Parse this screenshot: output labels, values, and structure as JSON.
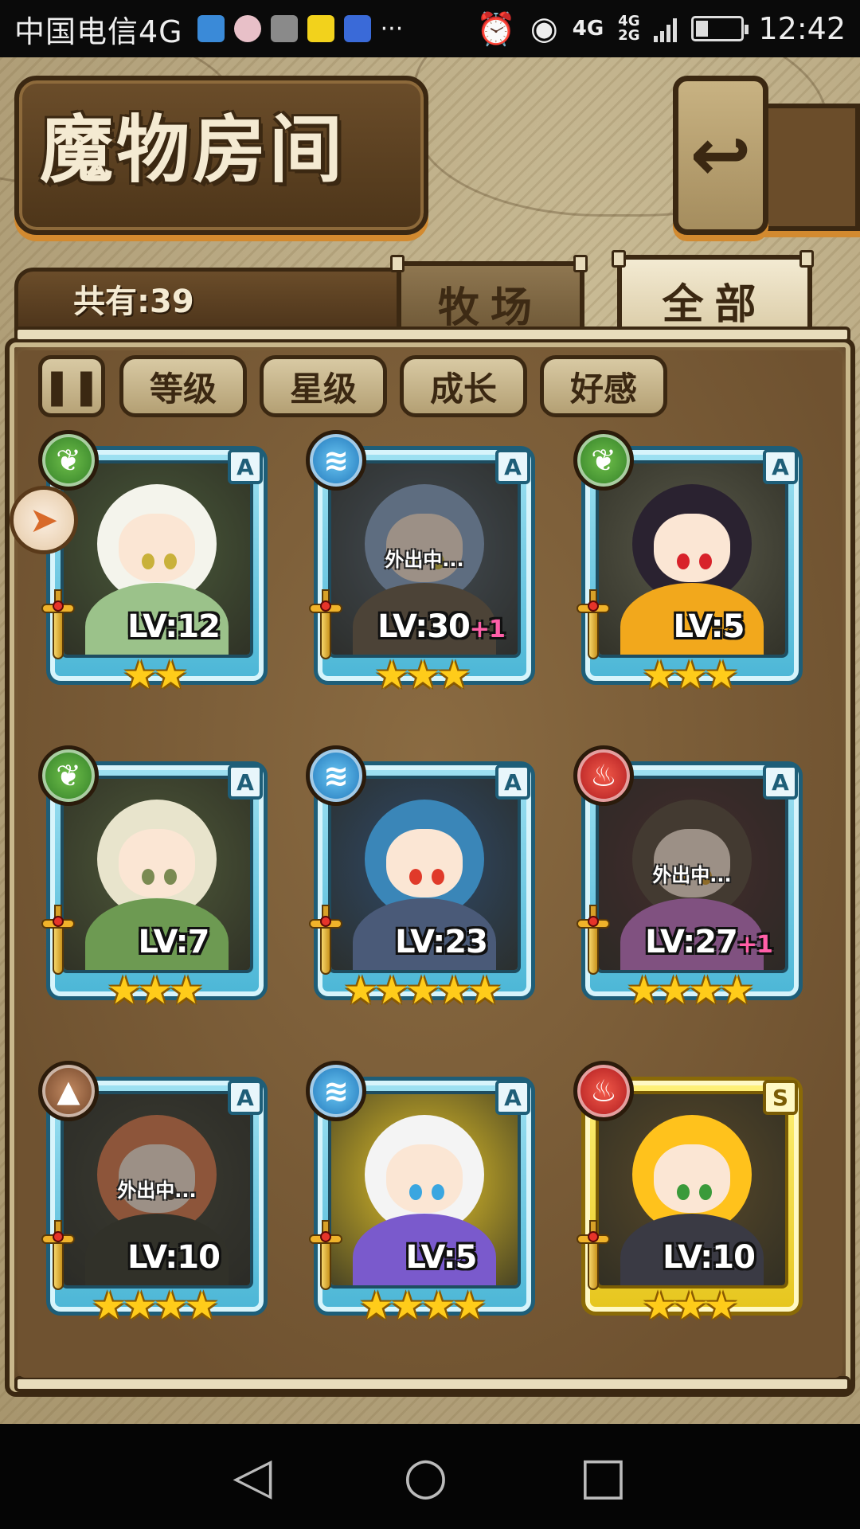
{
  "status_bar": {
    "carrier": "中国电信4G",
    "notification_icons": [
      "health-icon",
      "avatar-icon",
      "gallery-icon",
      "kuaikan-icon",
      "baidu-icon",
      "more-icon"
    ],
    "more": "···",
    "right_icons": [
      "alarm-icon",
      "eye-icon"
    ],
    "net1": "4G",
    "net2": "4G\n2G",
    "time": "12:42",
    "battery_level": 0.25
  },
  "header": {
    "title": "魔物房间",
    "back_glyph": "⎗"
  },
  "summary": {
    "count_label": "共有:39"
  },
  "tabs": [
    {
      "label": "牧场",
      "active": false
    },
    {
      "label": "全部",
      "active": true
    }
  ],
  "filters": {
    "toggle_glyph": "⏸",
    "buttons": [
      "等级",
      "星级",
      "成长",
      "好感"
    ]
  },
  "side_badge_glyph": "⟳",
  "monsters": [
    {
      "element": "wood",
      "element_glyph": "❦",
      "rank": "A",
      "level": "LV:12",
      "bonus": "",
      "stars": 2,
      "away": false,
      "frame": "blue",
      "bg": "#4a5a3a",
      "hair": "#f4f4ec",
      "outfit": "#9bc28a",
      "eye": "#c9b13a"
    },
    {
      "element": "water",
      "element_glyph": "≋",
      "rank": "A",
      "level": "LV:30",
      "bonus": "+1",
      "stars": 3,
      "away": true,
      "frame": "blue",
      "bg": "#5a6a78",
      "hair": "#8aa6c8",
      "outfit": "#6b5a44",
      "eye": "#d8c23a"
    },
    {
      "element": "wood",
      "element_glyph": "❦",
      "rank": "A",
      "level": "LV:5",
      "bonus": "",
      "stars": 3,
      "away": false,
      "frame": "blue",
      "bg": "#5a5a4a",
      "hair": "#2a2230",
      "outfit": "#f2a81c",
      "eye": "#d8222a"
    },
    {
      "element": "wood",
      "element_glyph": "❦",
      "rank": "A",
      "level": "LV:7",
      "bonus": "",
      "stars": 3,
      "away": false,
      "frame": "blue",
      "bg": "#4f5a3a",
      "hair": "#e8e4cc",
      "outfit": "#6d9a52",
      "eye": "#7a8a52"
    },
    {
      "element": "water",
      "element_glyph": "≋",
      "rank": "A",
      "level": "LV:23",
      "bonus": "",
      "stars": 5,
      "away": false,
      "frame": "blue",
      "bg": "#2f4a6a",
      "hair": "#3a86b8",
      "outfit": "#4a5a78",
      "eye": "#e03a2a"
    },
    {
      "element": "fire",
      "element_glyph": "♨",
      "rank": "A",
      "level": "LV:27",
      "bonus": "+1",
      "stars": 4,
      "away": true,
      "frame": "blue",
      "bg": "#5a3030",
      "hair": "#5a4a3a",
      "outfit": "#c874c8",
      "eye": "#e0a22a"
    },
    {
      "element": "earth",
      "element_glyph": "▲",
      "rank": "A",
      "level": "LV:10",
      "bonus": "",
      "stars": 4,
      "away": true,
      "frame": "blue",
      "bg": "#4a4a3a",
      "hair": "#e07a4a",
      "outfit": "#3a3a2a",
      "eye": "#4a3a2a"
    },
    {
      "element": "water",
      "element_glyph": "≋",
      "rank": "A",
      "level": "LV:5",
      "bonus": "",
      "stars": 4,
      "away": false,
      "frame": "blue",
      "bg": "#e8c72a",
      "hair": "#f4f4f4",
      "outfit": "#7a5acc",
      "eye": "#3aa6e0"
    },
    {
      "element": "fire",
      "element_glyph": "♨",
      "rank": "S",
      "level": "LV:10",
      "bonus": "",
      "stars": 3,
      "away": false,
      "frame": "gold",
      "bg": "#5a4a2a",
      "hair": "#ffc21c",
      "outfit": "#3a3a44",
      "eye": "#3a9a3a"
    }
  ],
  "away_label": "外出中...",
  "star_glyph": "★",
  "nav": {
    "back": "◁",
    "home": "○",
    "recent": "□"
  }
}
